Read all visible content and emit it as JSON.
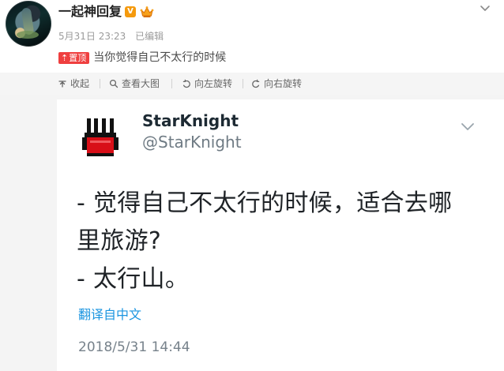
{
  "post": {
    "username": "一起神回复",
    "verified_badge": "V",
    "date_time": "5月31日 23:23",
    "edited": "已编辑",
    "pin_label": "置顶",
    "text": "当你觉得自己不太行的时候"
  },
  "toolbar": {
    "collapse": "收起",
    "view_large": "查看大图",
    "rotate_left": "向左旋转",
    "rotate_right": "向右旋转"
  },
  "tweet": {
    "name": "StarKnight",
    "handle": "@StarKnight",
    "lines": [
      "- 觉得自己不太行的时候，适合去哪",
      "里旅游?",
      "- 太行山。"
    ],
    "translate": "翻译自中文",
    "timestamp": "2018/5/31 14:44"
  },
  "icons": {
    "crown": "crown-icon",
    "dropdown": "chevron-down-icon",
    "collapse": "collapse-icon",
    "search": "search-icon",
    "rotate_left": "rotate-left-icon",
    "rotate_right": "rotate-right-icon",
    "tweet_avatar": "starknight-avatar-icon",
    "caret": "chevron-down-icon"
  },
  "colors": {
    "weibo_verified": "#f59a0d",
    "pin_red": "#ef3f3f",
    "toolbar_bg": "#f5f5f5",
    "twitter_link": "#1b95e0"
  }
}
